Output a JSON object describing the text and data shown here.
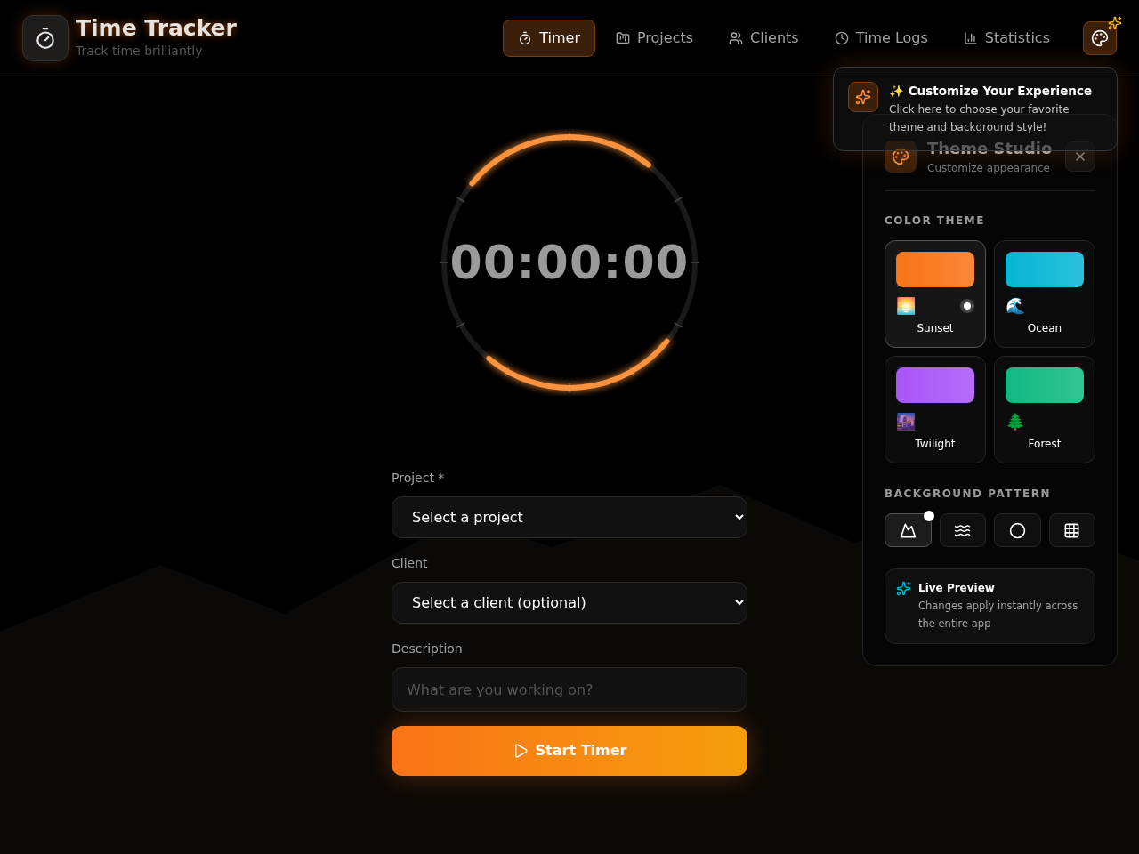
{
  "app": {
    "title": "Time Tracker",
    "subtitle": "Track time brilliantly"
  },
  "nav": [
    {
      "label": "Timer",
      "selected": true
    },
    {
      "label": "Projects",
      "selected": false
    },
    {
      "label": "Clients",
      "selected": false
    },
    {
      "label": "Time Logs",
      "selected": false
    },
    {
      "label": "Statistics",
      "selected": false
    }
  ],
  "tooltip": {
    "title": "✨ Customize Your Experience",
    "text": "Click here to choose your favorite theme and background style!"
  },
  "theme_studio": {
    "title": "Theme Studio",
    "subtitle": "Customize appearance",
    "color_theme_heading": "COLOR THEME",
    "themes": [
      {
        "name": "Sunset",
        "emoji": "🌅",
        "color": "#f97316",
        "selected": true
      },
      {
        "name": "Ocean",
        "emoji": "🌊",
        "color": "#06b6d4",
        "selected": false
      },
      {
        "name": "Twilight",
        "emoji": "🌆",
        "color": "#a855f7",
        "selected": false
      },
      {
        "name": "Forest",
        "emoji": "🌲",
        "color": "#10b981",
        "selected": false
      }
    ],
    "pattern_heading": "BACKGROUND PATTERN",
    "patterns": [
      {
        "kind": "mountains",
        "selected": true
      },
      {
        "kind": "waves",
        "selected": false
      },
      {
        "kind": "circles",
        "selected": false
      },
      {
        "kind": "grid",
        "selected": false
      }
    ],
    "live_preview": {
      "title": "Live Preview",
      "text": "Changes apply instantly across the entire app"
    }
  },
  "timer": {
    "display": "00:00:00"
  },
  "form": {
    "project": {
      "label": "Project *",
      "value": "Select a project"
    },
    "client": {
      "label": "Client",
      "value": "Select a client (optional)"
    },
    "description": {
      "label": "Description",
      "placeholder": "What are you working on?"
    },
    "start_button": "Start Timer"
  }
}
